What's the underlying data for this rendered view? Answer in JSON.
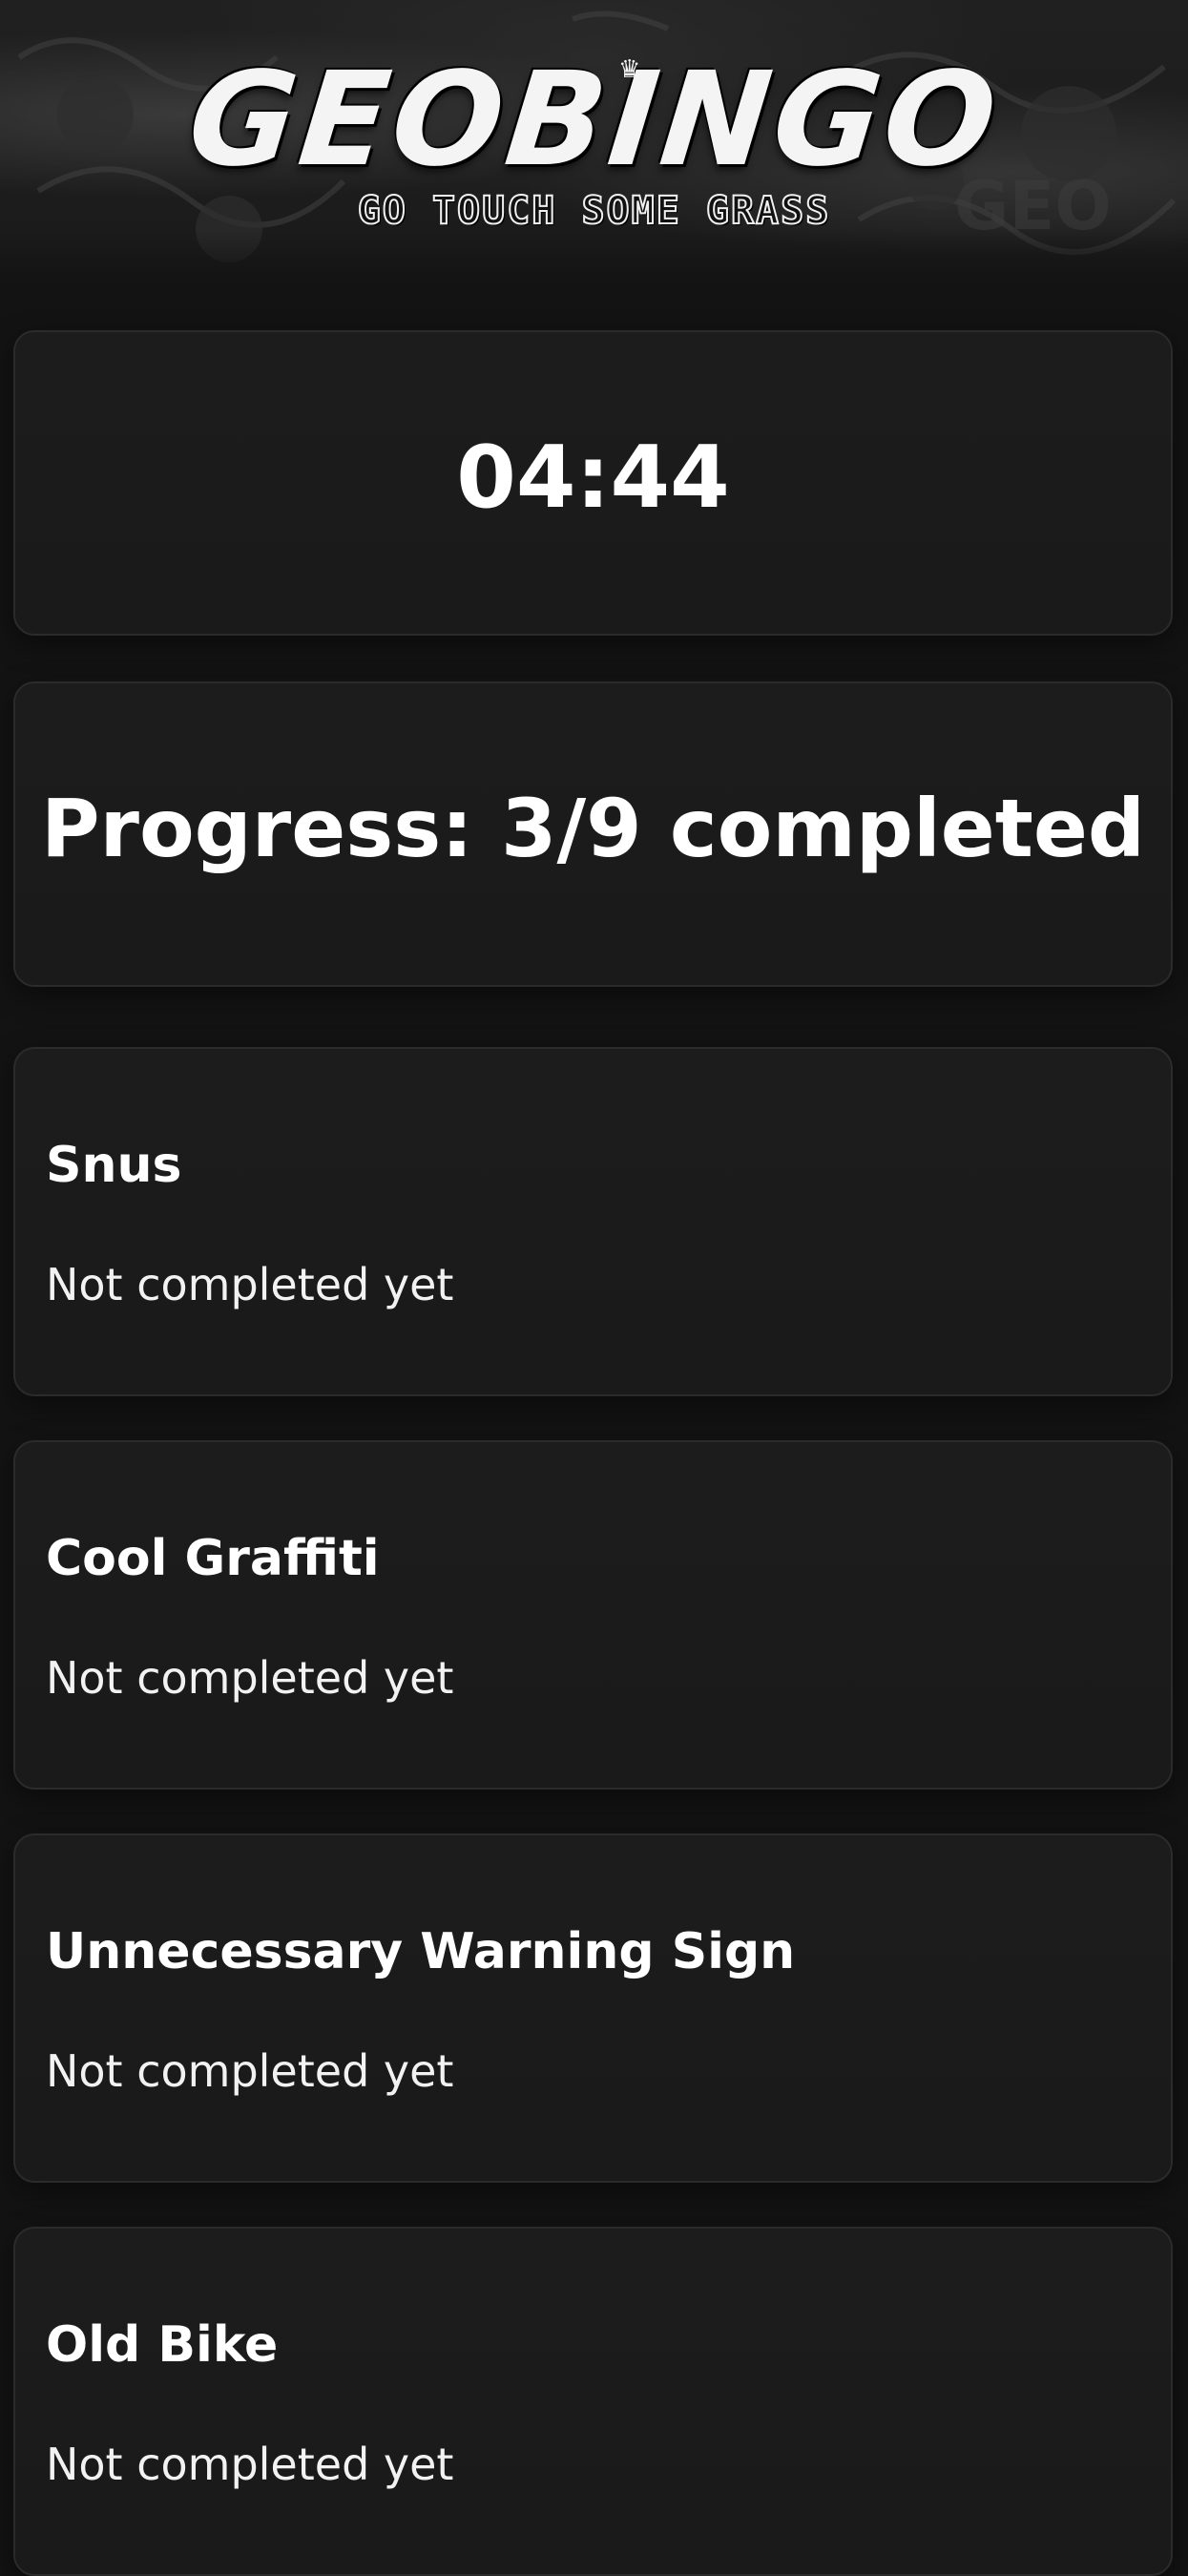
{
  "header": {
    "title": "GEOBINGO",
    "tagline": "GO TOUCH SOME GRASS",
    "crown_icon": "crown-icon"
  },
  "timer": {
    "value": "04:44"
  },
  "progress": {
    "label": "Progress: 3/9 completed",
    "completed": 3,
    "total": 9
  },
  "tasks": [
    {
      "title": "Snus",
      "status": "Not completed yet"
    },
    {
      "title": "Cool Graffiti",
      "status": "Not completed yet"
    },
    {
      "title": "Unnecessary Warning Sign",
      "status": "Not completed yet"
    },
    {
      "title": "Old Bike",
      "status": "Not completed yet"
    }
  ],
  "colors": {
    "background": "#131313",
    "card": "#1b1b1b",
    "card_border": "#2b2b2b",
    "text": "#ffffff"
  }
}
